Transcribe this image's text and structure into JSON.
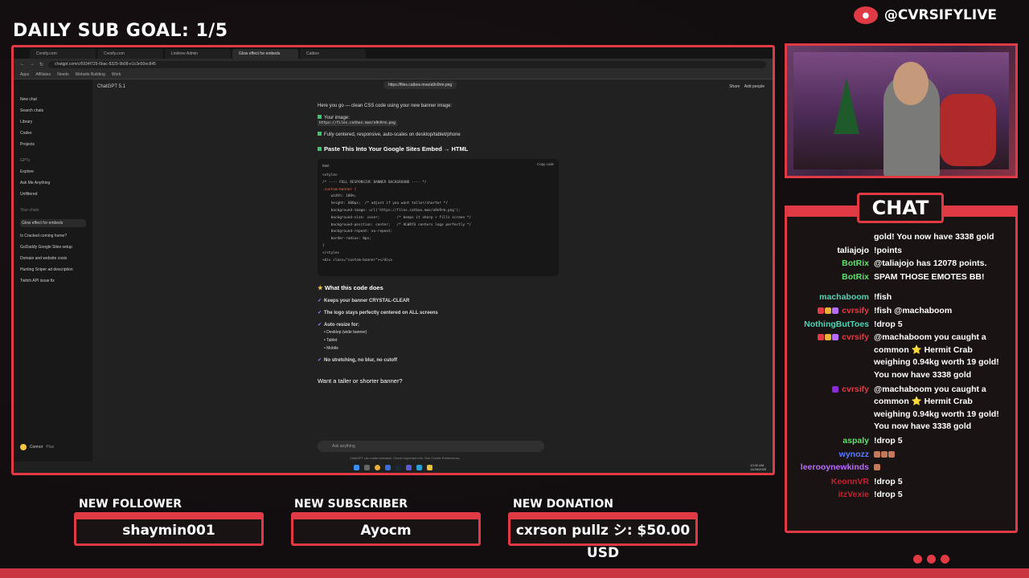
{
  "overlay": {
    "sub_goal": "DAILY SUB GOAL: 1/5",
    "handle": "@CVRSIFYLIVE",
    "chat_title": "CHAT",
    "alerts": [
      {
        "label": "NEW FOLLOWER",
        "value": "shaymin001"
      },
      {
        "label": "NEW SUBSCRIBER",
        "value": "Ayocm"
      },
      {
        "label": "NEW DONATION",
        "value": "cxrson pullz シ: $50.00 USD"
      }
    ],
    "accent": "#e03a45"
  },
  "browser": {
    "tabs": [
      "Cvrsify.com",
      "Cvrsify.com",
      "Linktree Admin",
      "Glow effect for embeds",
      "Catbox"
    ],
    "url": "chatgpt.com/c/6934f729-6bac-8329-9b08-e1c3e50ec845",
    "bookmarks": [
      "Apps",
      "Affiliates",
      "Needs",
      "Website Building",
      "Work"
    ]
  },
  "chatgpt": {
    "model": "ChatGPT 5.1",
    "share": "Share",
    "add_people": "Add people",
    "top_link": "https://files.catbox.moe/a9n9rm.png",
    "sidebar": {
      "new_chat": "New chat",
      "search": "Search chats",
      "library": "Library",
      "codex": "Codex",
      "projects": "Projects",
      "gpts_header": "GPTs",
      "explore": "Explore",
      "ask_me": "Ask Me Anything",
      "unfiltered": "Unfiltered",
      "chats_header": "Your chats",
      "chats": [
        "Glow effect for embeds",
        "Is Cracked coming home?",
        "GoDaddy Google Sites setup",
        "Domain and website costs",
        "Hunting Sniper ad description",
        "Twitch API issue fix"
      ],
      "user": "Connor",
      "plan": "Plus"
    },
    "intro": "Here you go — clean CSS code using your new banner image:",
    "your_image_label": "Your image:",
    "your_image_url": "https://files.catbox.moe/a9n9rm.png",
    "centered_note": "Fully centered, responsive, auto-scales on desktop/tablet/phone",
    "paste_heading": "Paste This Into Your Google Sites Embed → HTML",
    "code_lang": "html",
    "copy_label": "Copy code",
    "code_lines": [
      "<style>",
      "/* ---- FULL RESPONSIVE BANNER BACKGROUND ---- */",
      ".custom-banner {",
      "    width: 100%;",
      "    height: 600px;  /* adjust if you want taller/shorter */",
      "    background-image: url('https://files.catbox.moe/a9n9rm.png');",
      "    background-size: cover;        /* keeps it sharp + fills screen */",
      "    background-position: center;   /* ALWAYS centers logo perfectly */",
      "    background-repeat: no-repeat;",
      "    border-radius: 0px;",
      "}",
      "</style>",
      "",
      "<div class=\"custom-banner\"></div>"
    ],
    "what_heading": "What this code does",
    "points": [
      "Keeps your banner CRYSTAL-CLEAR",
      "The logo stays perfectly centered on ALL screens",
      "Auto resize for:"
    ],
    "devices": [
      "Desktop (wide banner)",
      "Tablet",
      "Mobile"
    ],
    "no_stretch": "No stretching, no blur, no cutoff",
    "question": "Want a taller or shorter banner?",
    "ask_placeholder": "Ask anything",
    "disclaimer": "ChatGPT can make mistakes. Check important info. See Cookie Preferences.",
    "clock": "10:32 AM",
    "date": "11/26/2025"
  },
  "chat_messages": [
    {
      "user": "",
      "color": "#ffffff",
      "text": "gold! You now have 3338 gold"
    },
    {
      "user": "taliajojo",
      "color": "#ffffff",
      "text": "!points"
    },
    {
      "user": "BotRix",
      "color": "#5fe06a",
      "text": "@taliajojo has 12078 points."
    },
    {
      "user": "BotRix",
      "color": "#5fe06a",
      "text": "SPAM THOSE EMOTES BB!"
    },
    {
      "user": "machaboom",
      "color": "#4fd3b4",
      "text": "!fish"
    },
    {
      "user": "cvrsify",
      "color": "#e03a45",
      "text": "!fish @machaboom"
    },
    {
      "user": "NothingButToes",
      "color": "#4fd3b4",
      "text": "!drop 5"
    },
    {
      "user": "cvrsify",
      "color": "#e03a45",
      "text": "@machaboom you caught a common ⭐ Hermit Crab weighing 0.94kg worth 19 gold! You now have 3338 gold"
    },
    {
      "user": "cvrsify",
      "color": "#e03a45",
      "text": "@machaboom you caught a common ⭐ Hermit Crab weighing 0.94kg worth 19 gold! You now have 3338 gold"
    },
    {
      "user": "aspaly",
      "color": "#5fe06a",
      "text": "!drop 5"
    },
    {
      "user": "wynozz",
      "color": "#5b7bff",
      "text": ""
    },
    {
      "user": "leerooynewkinds",
      "color": "#b86bff",
      "text": ""
    },
    {
      "user": "KeonnVR",
      "color": "#c0232f",
      "text": "!drop 5"
    },
    {
      "user": "itzVexie",
      "color": "#c0232f",
      "text": "!drop 5"
    }
  ]
}
